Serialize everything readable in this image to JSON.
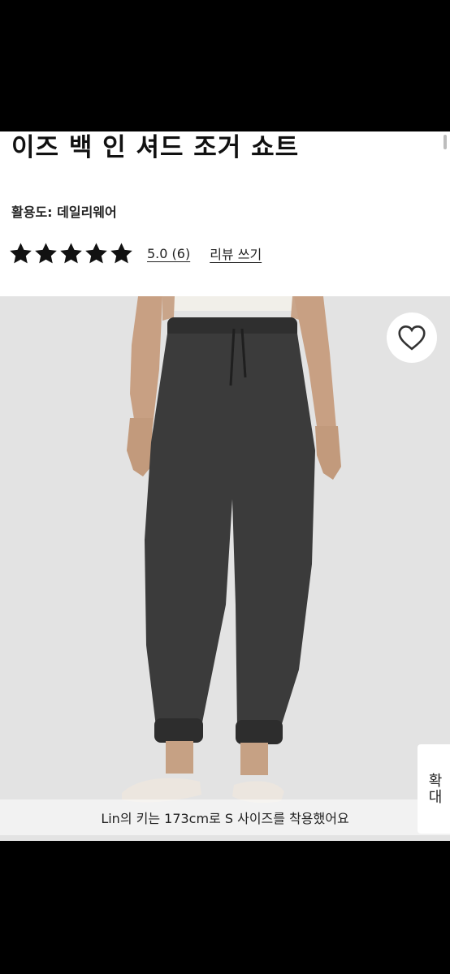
{
  "product": {
    "title": "이즈 백 인 셔드 조거 쇼트",
    "usage": "활용도: 데일리웨어",
    "rating_text": "5.0 (6)",
    "review_link": "리뷰 쓰기",
    "stars": 5
  },
  "photo": {
    "caption": "Lin의 키는 173cm로 S 사이즈를 착용했어요",
    "zoom_label": "확대",
    "wishlist_icon": "heart-outline-icon"
  },
  "colors": {
    "background": "#ffffff",
    "photo_bg": "#e3e3e3",
    "pants": "#3b3b3b"
  }
}
